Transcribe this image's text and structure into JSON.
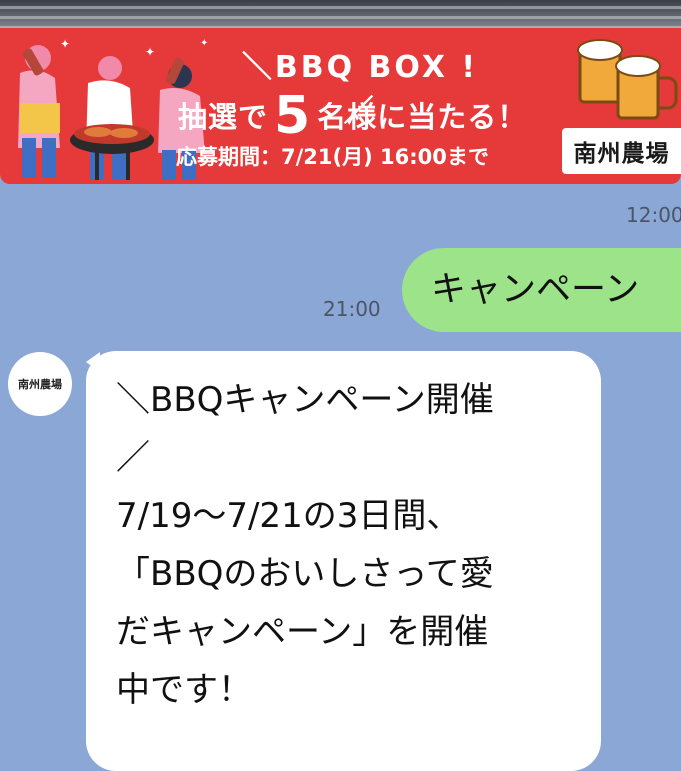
{
  "banner": {
    "title": "＼BBQ BOX !／",
    "lottery_prefix": "抽選で",
    "lottery_count": "5",
    "lottery_suffix": "名様に当たる！",
    "deadline": "応募期間：7/21(月) 16:00まで",
    "brand": "南州農場"
  },
  "chat": {
    "timestamp_top": "12:00",
    "outgoing_message": "キャンペーン",
    "outgoing_time": "21:00",
    "avatar_label": "南州農場",
    "incoming_message": "＼BBQキャンペーン開催\n／\n7/19〜7/21の3日間、\n「BBQのおいしさって愛\nだキャンペーン」を開催\n中です！"
  },
  "colors": {
    "background": "#8ba7d6",
    "banner_red": "#e5393a",
    "outgoing_bubble": "#9de38a",
    "incoming_bubble": "#ffffff"
  }
}
